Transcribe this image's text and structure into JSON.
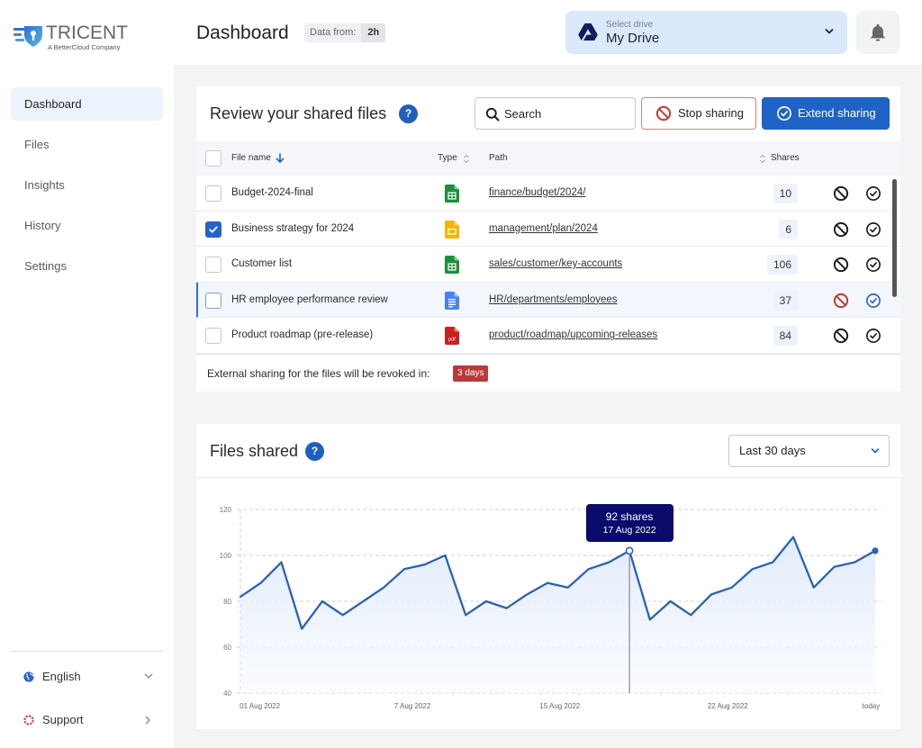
{
  "app": {
    "logo_name": "TRICENT",
    "logo_subtitle": "A BetterCloud Company"
  },
  "header": {
    "title": "Dashboard",
    "data_from_label": "Data from:",
    "data_from_value": "2h",
    "drive_select": {
      "label": "Select drive",
      "value": "My Drive",
      "icon": "google-drive-icon"
    },
    "notifications_icon": "bell-icon"
  },
  "sidebar": {
    "items": [
      {
        "label": "Dashboard",
        "active": true
      },
      {
        "label": "Files",
        "active": false
      },
      {
        "label": "Insights",
        "active": false
      },
      {
        "label": "History",
        "active": false
      },
      {
        "label": "Settings",
        "active": false
      }
    ],
    "language": {
      "label": "English",
      "icon": "globe-icon"
    },
    "support": {
      "label": "Support",
      "icon": "lifebuoy-icon"
    }
  },
  "shared_files": {
    "title": "Review your shared files",
    "help_label": "?",
    "search_placeholder": "Search",
    "stop_sharing_label": "Stop sharing",
    "extend_sharing_label": "Extend sharing",
    "columns": {
      "name": "File name",
      "type": "Type",
      "path": "Path",
      "shares": "Shares",
      "sorted_by": "name",
      "sort_direction": "descending"
    },
    "rows": [
      {
        "name": "Budget-2024-final",
        "type": "google-sheets",
        "path": "finance/budget/2024/",
        "shares": "10",
        "selected": false,
        "hovered": false
      },
      {
        "name": "Business strategy for 2024",
        "type": "google-slides",
        "path": "management/plan/2024",
        "shares": "6",
        "selected": true,
        "hovered": false
      },
      {
        "name": "Customer list",
        "type": "google-sheets",
        "path": "sales/customer/key-accounts",
        "shares": "106",
        "selected": false,
        "hovered": false
      },
      {
        "name": "HR employee performance review",
        "type": "google-docs",
        "path": "HR/departments/employees",
        "shares": "37",
        "selected": false,
        "hovered": true
      },
      {
        "name": "Product roadmap (pre-release)",
        "type": "pdf",
        "path": "product/roadmap/upcoming-releases",
        "shares": "84",
        "selected": false,
        "hovered": false
      }
    ],
    "footer_text": "External sharing for the files will be revoked in:",
    "revoke_badge": "3 days"
  },
  "files_shared": {
    "title": "Files shared",
    "help_label": "?",
    "range_select": "Last 30 days"
  },
  "colors": {
    "primary": "#1f63c6",
    "danger": "#c0392b",
    "badge_danger": "#b93a3a",
    "chart_line": "#2d62b0",
    "tooltip_bg": "#0b0b6b",
    "drive_select_bg": "#dce9fb",
    "active_nav_bg": "#edf3fd"
  },
  "chart_data": {
    "type": "area",
    "title": "Files shared",
    "xlabel": "",
    "ylabel": "",
    "ylim": [
      40,
      120
    ],
    "y_ticks": [
      120,
      100,
      80,
      60,
      40
    ],
    "grid": true,
    "x_ticks": [
      {
        "label": "01 Aug 2022",
        "index": 0.95
      },
      {
        "label": "7 Aug 2022",
        "index": 8.4
      },
      {
        "label": "15 Aug 2022",
        "index": 15.6
      },
      {
        "label": "22 Aug 2022",
        "index": 23.8
      },
      {
        "label": "today",
        "index": 30.8
      }
    ],
    "series": [
      {
        "name": "shares",
        "values": [
          82,
          88,
          97,
          68,
          80,
          74,
          80,
          86,
          94,
          96,
          100,
          74,
          80,
          77,
          83,
          88,
          86,
          94,
          97,
          102,
          72,
          80,
          74,
          83,
          86,
          94,
          97,
          108,
          86,
          95,
          97,
          102
        ]
      }
    ],
    "tooltip": {
      "index": 19,
      "value_label": "92 shares",
      "date_label": "17 Aug 2022"
    }
  }
}
